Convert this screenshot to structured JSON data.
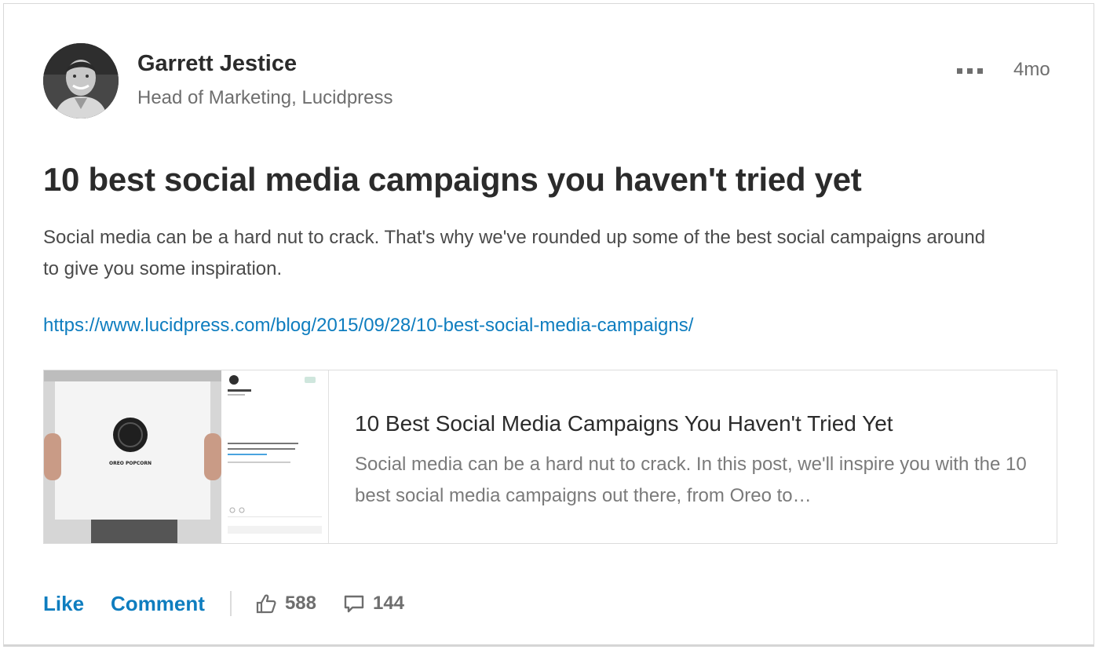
{
  "author": {
    "name": "Garrett Jestice",
    "headline": "Head of Marketing, Lucidpress"
  },
  "post": {
    "timestamp": "4mo",
    "title": "10 best social media campaigns you haven't tried yet",
    "body": "Social media can be a hard nut to crack. That's why we've rounded up some of the best social campaigns around to give you some inspiration.",
    "link": "https://www.lucidpress.com/blog/2015/09/28/10-best-social-media-campaigns/"
  },
  "preview": {
    "title": "10 Best Social Media Campaigns You Haven't Tried Yet",
    "description": "Social media can be a hard nut to crack. In this post, we'll inspire you with the 10 best social media campaigns out there, from Oreo to…",
    "thumbnail": {
      "card_text": "OREO POPCORN",
      "tweet_text": "We're the best thing to happen to popcorn since, well, ever. #OreoPopcorn"
    }
  },
  "actions": {
    "like_label": "Like",
    "comment_label": "Comment",
    "likes_count": "588",
    "comments_count": "144"
  },
  "colors": {
    "link": "#0e7dbf",
    "text_primary": "#2b2b2b",
    "text_secondary": "#6e6e6e"
  },
  "icons": {
    "more": "ellipsis-icon",
    "likes": "thumbs-up-icon",
    "comments": "comment-icon"
  }
}
